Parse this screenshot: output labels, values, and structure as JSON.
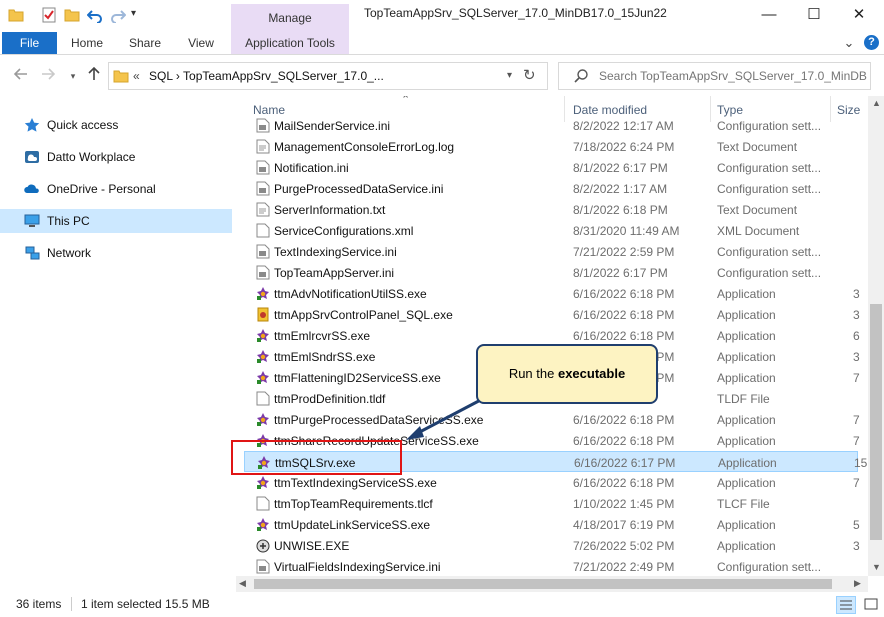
{
  "window": {
    "title": "TopTeamAppSrv_SQLServer_17.0_MinDB17.0_15Jun22",
    "context_tab": "Manage",
    "controls": {
      "minimize": "—",
      "maximize": "☐",
      "close": "✕"
    }
  },
  "ribbon": {
    "tabs": [
      "File",
      "Home",
      "Share",
      "View",
      "Application Tools"
    ],
    "chevron": "⌄",
    "help": "?"
  },
  "address": {
    "overflow": "«",
    "path": "SQL  ›  TopTeamAppSrv_SQLServer_17.0_...",
    "search_placeholder": "Search TopTeamAppSrv_SQLServer_17.0_MinDB17..."
  },
  "nav": {
    "items": [
      {
        "label": "Quick access",
        "icon": "star-icon"
      },
      {
        "label": "Datto Workplace",
        "icon": "cloud-sync-icon"
      },
      {
        "label": "OneDrive - Personal",
        "icon": "onedrive-icon"
      },
      {
        "label": "This PC",
        "icon": "computer-icon",
        "selected": true
      },
      {
        "label": "Network",
        "icon": "network-icon"
      }
    ]
  },
  "columns": [
    "Name",
    "Date modified",
    "Type",
    "Size"
  ],
  "files": [
    {
      "name": "MailSenderService.ini",
      "date": "8/2/2022 12:17 AM",
      "type": "Configuration sett...",
      "size": "",
      "icon": "ini-file-icon"
    },
    {
      "name": "ManagementConsoleErrorLog.log",
      "date": "7/18/2022 6:24 PM",
      "type": "Text Document",
      "size": "",
      "icon": "text-file-icon"
    },
    {
      "name": "Notification.ini",
      "date": "8/1/2022 6:17 PM",
      "type": "Configuration sett...",
      "size": "",
      "icon": "ini-file-icon"
    },
    {
      "name": "PurgeProcessedDataService.ini",
      "date": "8/2/2022 1:17 AM",
      "type": "Configuration sett...",
      "size": "",
      "icon": "ini-file-icon"
    },
    {
      "name": "ServerInformation.txt",
      "date": "8/1/2022 6:18 PM",
      "type": "Text Document",
      "size": "",
      "icon": "text-file-icon"
    },
    {
      "name": "ServiceConfigurations.xml",
      "date": "8/31/2020 11:49 AM",
      "type": "XML Document",
      "size": "",
      "icon": "xml-file-icon"
    },
    {
      "name": "TextIndexingService.ini",
      "date": "7/21/2022 2:59 PM",
      "type": "Configuration sett...",
      "size": "",
      "icon": "ini-file-icon"
    },
    {
      "name": "TopTeamAppServer.ini",
      "date": "8/1/2022 6:17 PM",
      "type": "Configuration sett...",
      "size": "",
      "icon": "ini-file-icon"
    },
    {
      "name": "ttmAdvNotificationUtilSS.exe",
      "date": "6/16/2022 6:18 PM",
      "type": "Application",
      "size": "3",
      "icon": "app-exe-icon"
    },
    {
      "name": "ttmAppSrvControlPanel_SQL.exe",
      "date": "6/16/2022 6:18 PM",
      "type": "Application",
      "size": "3",
      "icon": "control-panel-exe-icon"
    },
    {
      "name": "ttmEmlrcvrSS.exe",
      "date": "6/16/2022 6:18 PM",
      "type": "Application",
      "size": "6",
      "icon": "app-exe-icon"
    },
    {
      "name": "ttmEmlSndrSS.exe",
      "date": "6/16/2022 6:18 PM",
      "type": "Application",
      "size": "3",
      "icon": "app-exe-icon"
    },
    {
      "name": "ttmFlatteningID2ServiceSS.exe",
      "date": "6/16/2022 6:18 PM",
      "type": "Application",
      "size": "7",
      "icon": "app-exe-icon"
    },
    {
      "name": "ttmProdDefinition.tldf",
      "date": "",
      "type": "TLDF File",
      "size": "",
      "icon": "blank-file-icon"
    },
    {
      "name": "ttmPurgeProcessedDataServiceSS.exe",
      "date": "6/16/2022 6:18 PM",
      "type": "Application",
      "size": "7",
      "icon": "app-exe-icon"
    },
    {
      "name": "ttmShareRecordUpdateServiceSS.exe",
      "date": "6/16/2022 6:18 PM",
      "type": "Application",
      "size": "7",
      "icon": "app-exe-icon"
    },
    {
      "name": "ttmSQLSrv.exe",
      "date": "6/16/2022 6:17 PM",
      "type": "Application",
      "size": "15",
      "icon": "app-exe-icon",
      "selected": true
    },
    {
      "name": "ttmTextIndexingServiceSS.exe",
      "date": "6/16/2022 6:18 PM",
      "type": "Application",
      "size": "7",
      "icon": "app-exe-icon"
    },
    {
      "name": "ttmTopTeamRequirements.tlcf",
      "date": "1/10/2022 1:45 PM",
      "type": "TLCF File",
      "size": "",
      "icon": "blank-file-icon"
    },
    {
      "name": "ttmUpdateLinkServiceSS.exe",
      "date": "4/18/2017 6:19 PM",
      "type": "Application",
      "size": "5",
      "icon": "app-exe-icon"
    },
    {
      "name": "UNWISE.EXE",
      "date": "7/26/2022 5:02 PM",
      "type": "Application",
      "size": "3",
      "icon": "uninstaller-exe-icon"
    },
    {
      "name": "VirtualFieldsIndexingService.ini",
      "date": "7/21/2022 2:49 PM",
      "type": "Configuration sett...",
      "size": "",
      "icon": "ini-file-icon"
    }
  ],
  "status": {
    "item_count": "36 items",
    "selection": "1 item selected  15.5 MB"
  },
  "callout": {
    "prefix": "Run the ",
    "bold": "executable"
  },
  "colors": {
    "accent": "#1a6fc8",
    "selection": "#cce8ff",
    "context_tab": "#e9dcf5",
    "callout_fill": "#fdf3c2",
    "callout_border": "#1f3e6e",
    "highlight": "#e01515"
  }
}
